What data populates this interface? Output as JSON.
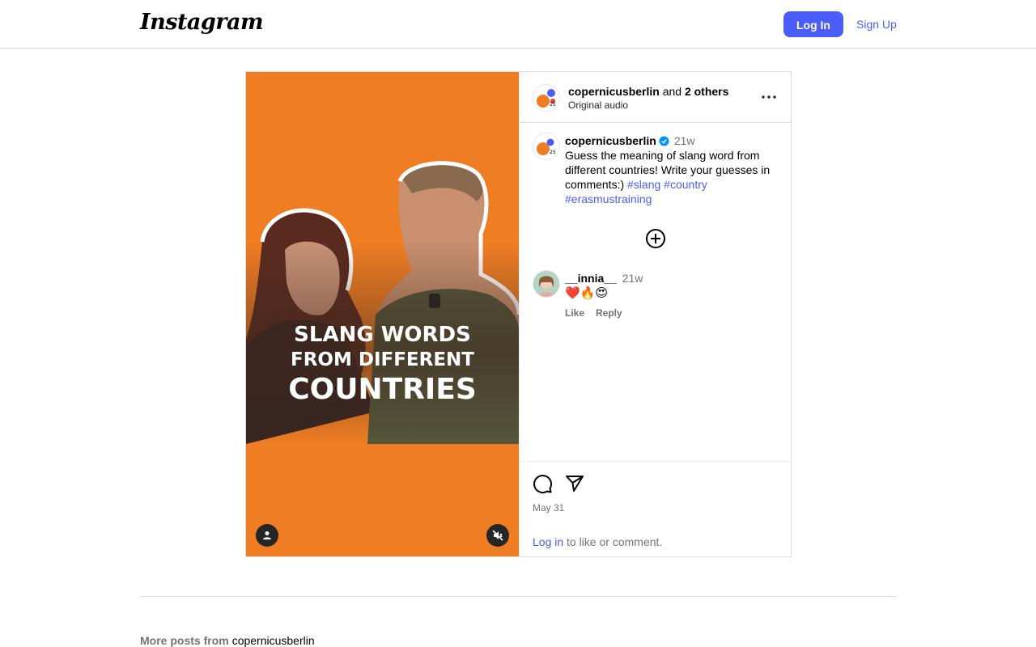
{
  "topbar": {
    "logo": "Instagram",
    "login_label": "Log In",
    "signup_label": "Sign Up"
  },
  "post": {
    "media": {
      "overlay_lines": [
        "SLANG WORDS",
        "FROM DIFFERENT",
        "COUNTRIES"
      ],
      "background_color": "#ef7d24"
    },
    "header": {
      "author": "copernicusberlin",
      "and_text": "and",
      "others": "2 others",
      "audio": "Original audio"
    },
    "caption": {
      "user": "copernicusberlin",
      "time": "21w",
      "text": "Guess the meaning of slang word from different countries! Write your guesses in comments:)",
      "hashtags": [
        "#slang",
        "#country",
        "#erasmustraining"
      ]
    },
    "comment": {
      "user": "__innia__",
      "time": "21w",
      "text": "❤️🔥😍",
      "like_label": "Like",
      "reply_label": "Reply"
    },
    "date": "May 31",
    "login_prompt": {
      "link": "Log in",
      "rest": "to like or comment."
    }
  },
  "more_posts": {
    "label": "More posts from",
    "user": "copernicusberlin"
  },
  "colors": {
    "accent": "#4a5df9",
    "verified": "#0095f6"
  }
}
